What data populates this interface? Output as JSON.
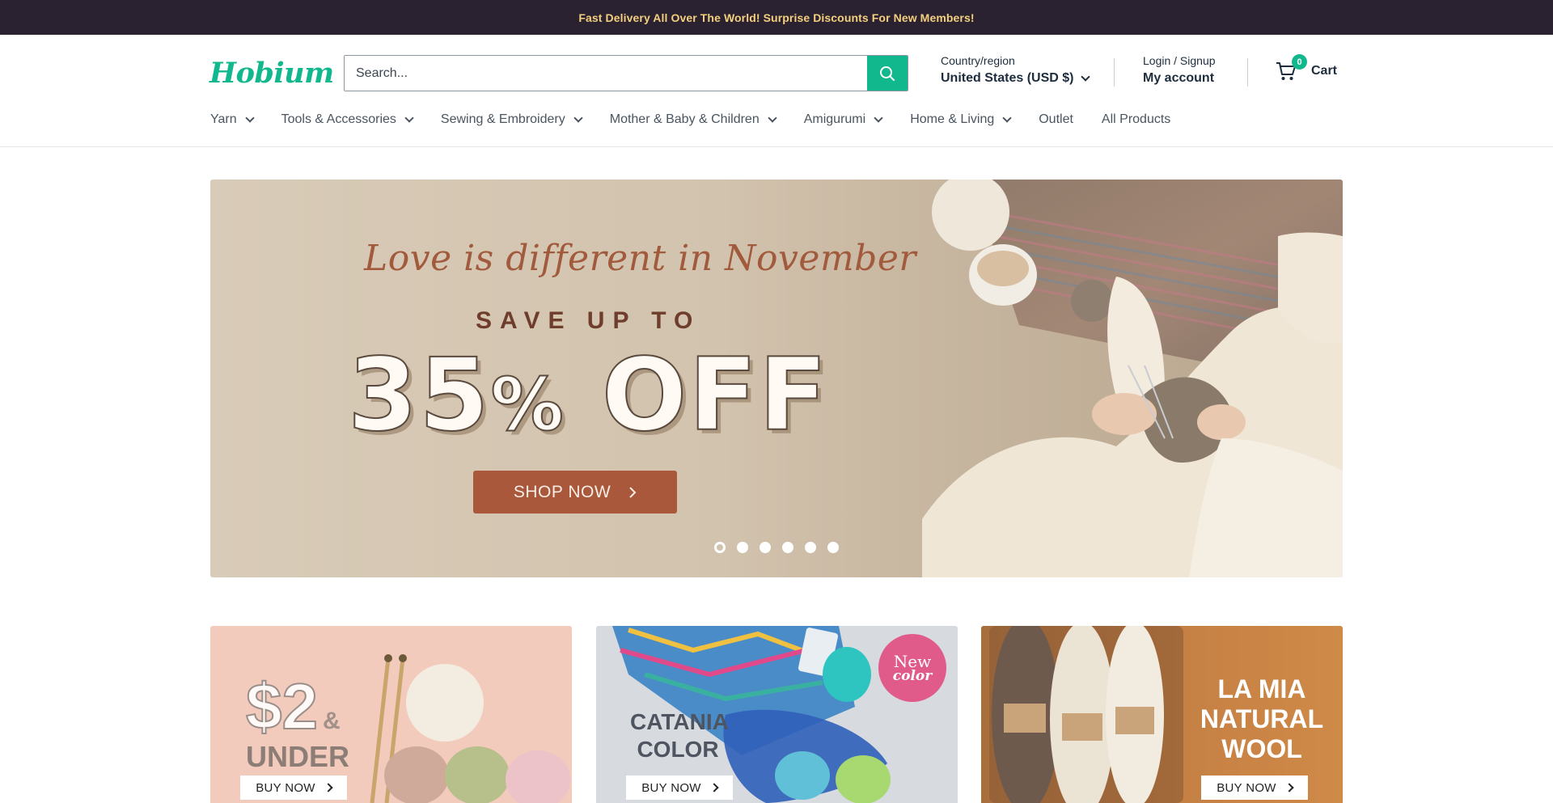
{
  "announcement": "Fast Delivery All Over The World! Surprise Discounts For New Members!",
  "brand": {
    "logo_text": "Hobium",
    "accent_color": "#12b88d"
  },
  "search": {
    "placeholder": "Search..."
  },
  "country": {
    "label": "Country/region",
    "value": "United States (USD $)"
  },
  "account": {
    "label": "Login / Signup",
    "value": "My account"
  },
  "cart": {
    "count": "0",
    "label": "Cart"
  },
  "nav": {
    "items": [
      {
        "label": "Yarn",
        "has_dropdown": true
      },
      {
        "label": "Tools & Accessories",
        "has_dropdown": true
      },
      {
        "label": "Sewing & Embroidery",
        "has_dropdown": true
      },
      {
        "label": "Mother & Baby & Children",
        "has_dropdown": true
      },
      {
        "label": "Amigurumi",
        "has_dropdown": true
      },
      {
        "label": "Home & Living",
        "has_dropdown": true
      },
      {
        "label": "Outlet",
        "has_dropdown": false
      },
      {
        "label": "All Products",
        "has_dropdown": false
      }
    ]
  },
  "hero": {
    "script_text": "Love is different in November",
    "save_text": "SAVE UP TO",
    "big_number": "35",
    "percent": "%",
    "off": " OFF",
    "button_label": "SHOP NOW",
    "slides_count": 6,
    "active_slide": 1
  },
  "promos": [
    {
      "title_big": "$2",
      "title_amp": "&",
      "title_rest": "UNDER",
      "button": "BUY NOW"
    },
    {
      "title": "CATANIA COLOR",
      "badge_line1": "New",
      "badge_line2": "color",
      "button": "BUY NOW"
    },
    {
      "title": "LA MIA NATURAL WOOL",
      "button": "BUY NOW"
    }
  ]
}
